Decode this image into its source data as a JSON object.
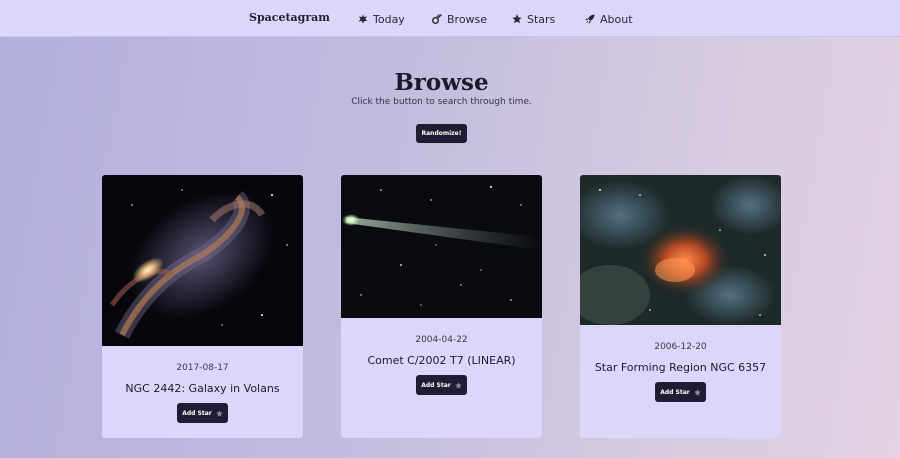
{
  "nav": {
    "brand": "Spacetagram",
    "links": [
      {
        "label": "Today",
        "icon": "asteroid-icon"
      },
      {
        "label": "Browse",
        "icon": "comet-icon"
      },
      {
        "label": "Stars",
        "icon": "star-icon"
      },
      {
        "label": "About",
        "icon": "rocket-icon"
      }
    ]
  },
  "hero": {
    "title": "Browse",
    "subtitle": "Click the button to search through time.",
    "button_label": "Randomize!"
  },
  "cards": [
    {
      "date": "2017-08-17",
      "title": "NGC 2442: Galaxy in Volans",
      "button_label": "Add Star",
      "button_icon": "star-icon"
    },
    {
      "date": "2004-04-22",
      "title": "Comet C/2002 T7 (LINEAR)",
      "button_label": "Add Star",
      "button_icon": "star-icon"
    },
    {
      "date": "2006-12-20",
      "title": "Star Forming Region NGC 6357",
      "button_label": "Add Star",
      "button_icon": "star-icon"
    }
  ],
  "colors": {
    "navbar": "#dad7fb",
    "card": "#dad7fb",
    "button": "#1f1c34",
    "background_start": "#b2afdc",
    "background_end": "#e2d3e2"
  }
}
